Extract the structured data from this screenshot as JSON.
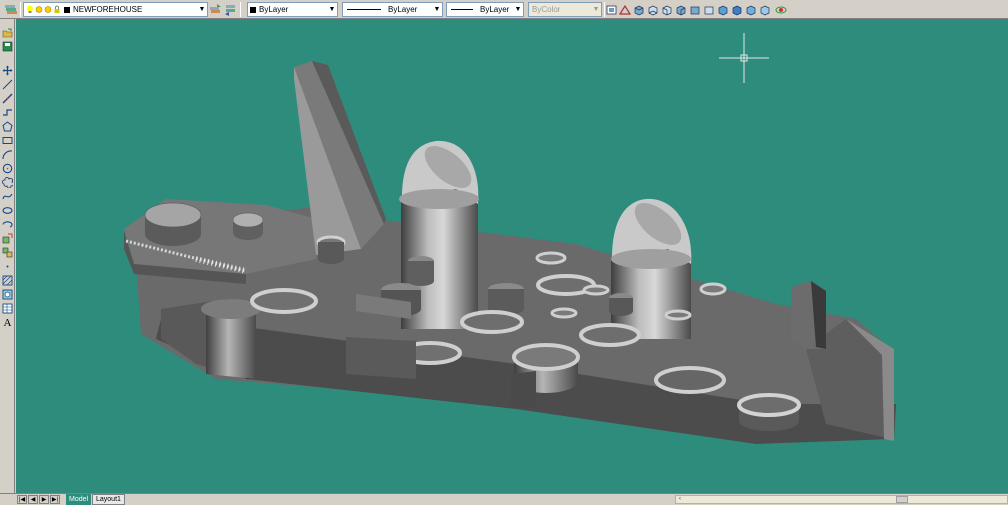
{
  "toolbar": {
    "layer_name": "NEWFOREHOUSE",
    "color": "ByLayer",
    "linetype": "ByLayer",
    "lineweight": "ByLayer",
    "plotstyle": "ByColor"
  },
  "icons": {
    "layer_manager": "layers-icon",
    "layer_state": "lightbulb-icon",
    "make_current": "make-current-icon",
    "layer_previous": "layer-previous-icon",
    "view_icons": [
      "named-views-icon",
      "top-view-icon",
      "bottom-view-icon",
      "left-view-icon",
      "right-view-icon",
      "front-view-icon",
      "back-view-icon",
      "sw-iso-icon",
      "se-iso-icon",
      "ne-iso-icon",
      "nw-iso-icon",
      "camera-icon"
    ],
    "left_tools": [
      "open-icon",
      "save-icon",
      "pan-icon",
      "line-icon",
      "construction-line-icon",
      "polyline-icon",
      "polygon-icon",
      "rectangle-icon",
      "arc-icon",
      "circle-icon",
      "revision-cloud-icon",
      "spline-icon",
      "ellipse-icon",
      "ellipse-arc-icon",
      "insert-block-icon",
      "make-block-icon",
      "point-icon",
      "hatch-icon",
      "region-icon",
      "table-icon",
      "multiline-text-icon"
    ],
    "accent_green": "#2e8c7c"
  },
  "tabs": {
    "model": "Model",
    "layout1": "Layout1"
  }
}
